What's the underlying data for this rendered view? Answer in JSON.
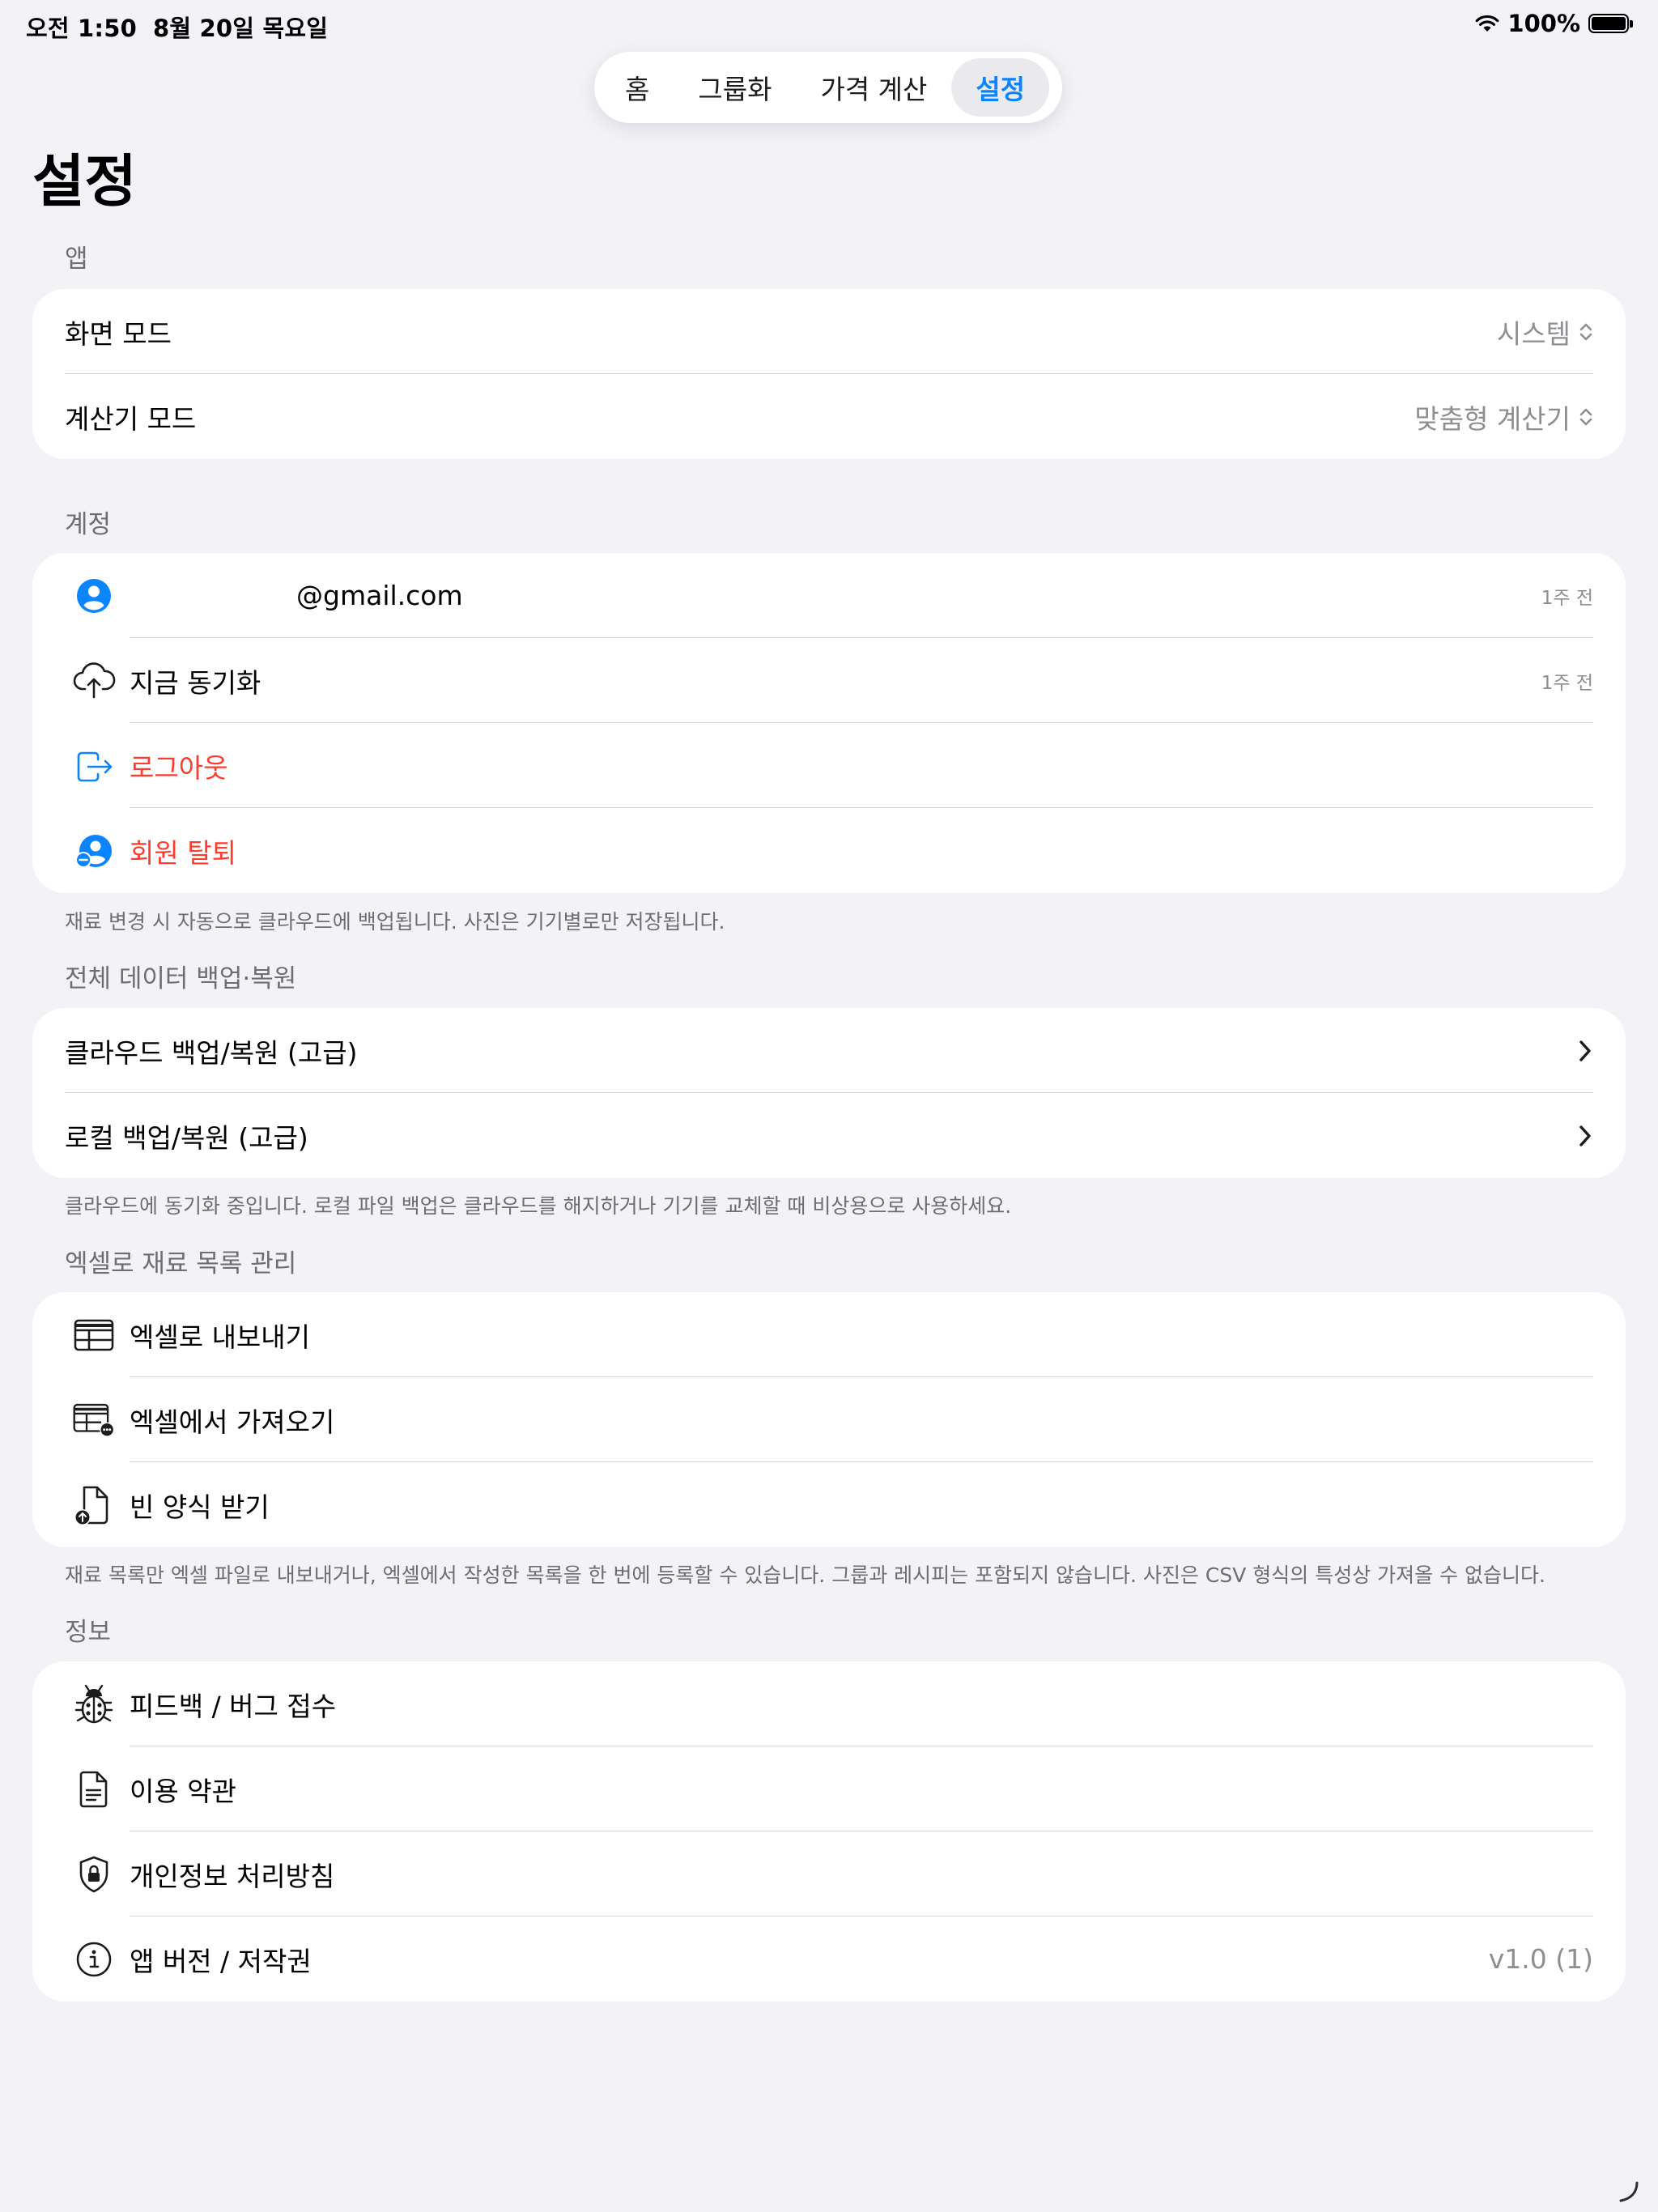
{
  "status": {
    "time": "오전 1:50",
    "date": "8월 20일 목요일",
    "battery": "100%"
  },
  "tabs": [
    {
      "label": "홈"
    },
    {
      "label": "그룹화"
    },
    {
      "label": "가격 계산"
    },
    {
      "label": "설정"
    }
  ],
  "page": {
    "title": "설정"
  },
  "app_section": {
    "header": "앱",
    "rows": [
      {
        "label": "화면 모드",
        "value": "시스템"
      },
      {
        "label": "계산기 모드",
        "value": "맞춤형 계산기"
      }
    ]
  },
  "account_section": {
    "header": "계정",
    "rows": [
      {
        "label": "@gmail.com",
        "time": "1주 전",
        "icon": "person-circle-icon"
      },
      {
        "label": "지금 동기화",
        "time": "1주 전",
        "icon": "cloud-upload-icon"
      },
      {
        "label": "로그아웃",
        "icon": "logout-icon"
      },
      {
        "label": "회원 탈퇴",
        "icon": "delete-account-icon"
      }
    ],
    "footer": "재료 변경 시 자동으로 클라우드에 백업됩니다. 사진은 기기별로만 저장됩니다."
  },
  "backup_section": {
    "header": "전체 데이터 백업·복원",
    "rows": [
      {
        "label": "클라우드 백업/복원 (고급)"
      },
      {
        "label": "로컬 백업/복원 (고급)"
      }
    ],
    "footer": "클라우드에 동기화 중입니다. 로컬 파일 백업은 클라우드를 해지하거나 기기를 교체할 때 비상용으로 사용하세요."
  },
  "excel_section": {
    "header": "엑셀로 재료 목록 관리",
    "rows": [
      {
        "label": "엑셀로 내보내기",
        "icon": "table-icon"
      },
      {
        "label": "엑셀에서 가져오기",
        "icon": "table-import-icon"
      },
      {
        "label": "빈 양식 받기",
        "icon": "blank-template-icon"
      }
    ],
    "footer": "재료 목록만 엑셀 파일로 내보내거나, 엑셀에서 작성한 목록을 한 번에 등록할 수 있습니다. 그룹과 레시피는 포함되지 않습니다. 사진은 CSV 형식의 특성상 가져올 수 없습니다."
  },
  "info_section": {
    "header": "정보",
    "rows": [
      {
        "label": "피드백 / 버그 접수",
        "icon": "ladybug-icon"
      },
      {
        "label": "이용 약관",
        "icon": "document-icon"
      },
      {
        "label": "개인정보 처리방침",
        "icon": "lock-shield-icon"
      },
      {
        "label": "앱 버전 / 저작권",
        "value": "v1.0 (1)",
        "icon": "info-icon"
      }
    ]
  },
  "colors": {
    "accent": "#0a84ff",
    "destructive": "#ff3b30",
    "background": "#f2f2f7",
    "card": "#ffffff",
    "secondary_text": "#8e8e93"
  }
}
